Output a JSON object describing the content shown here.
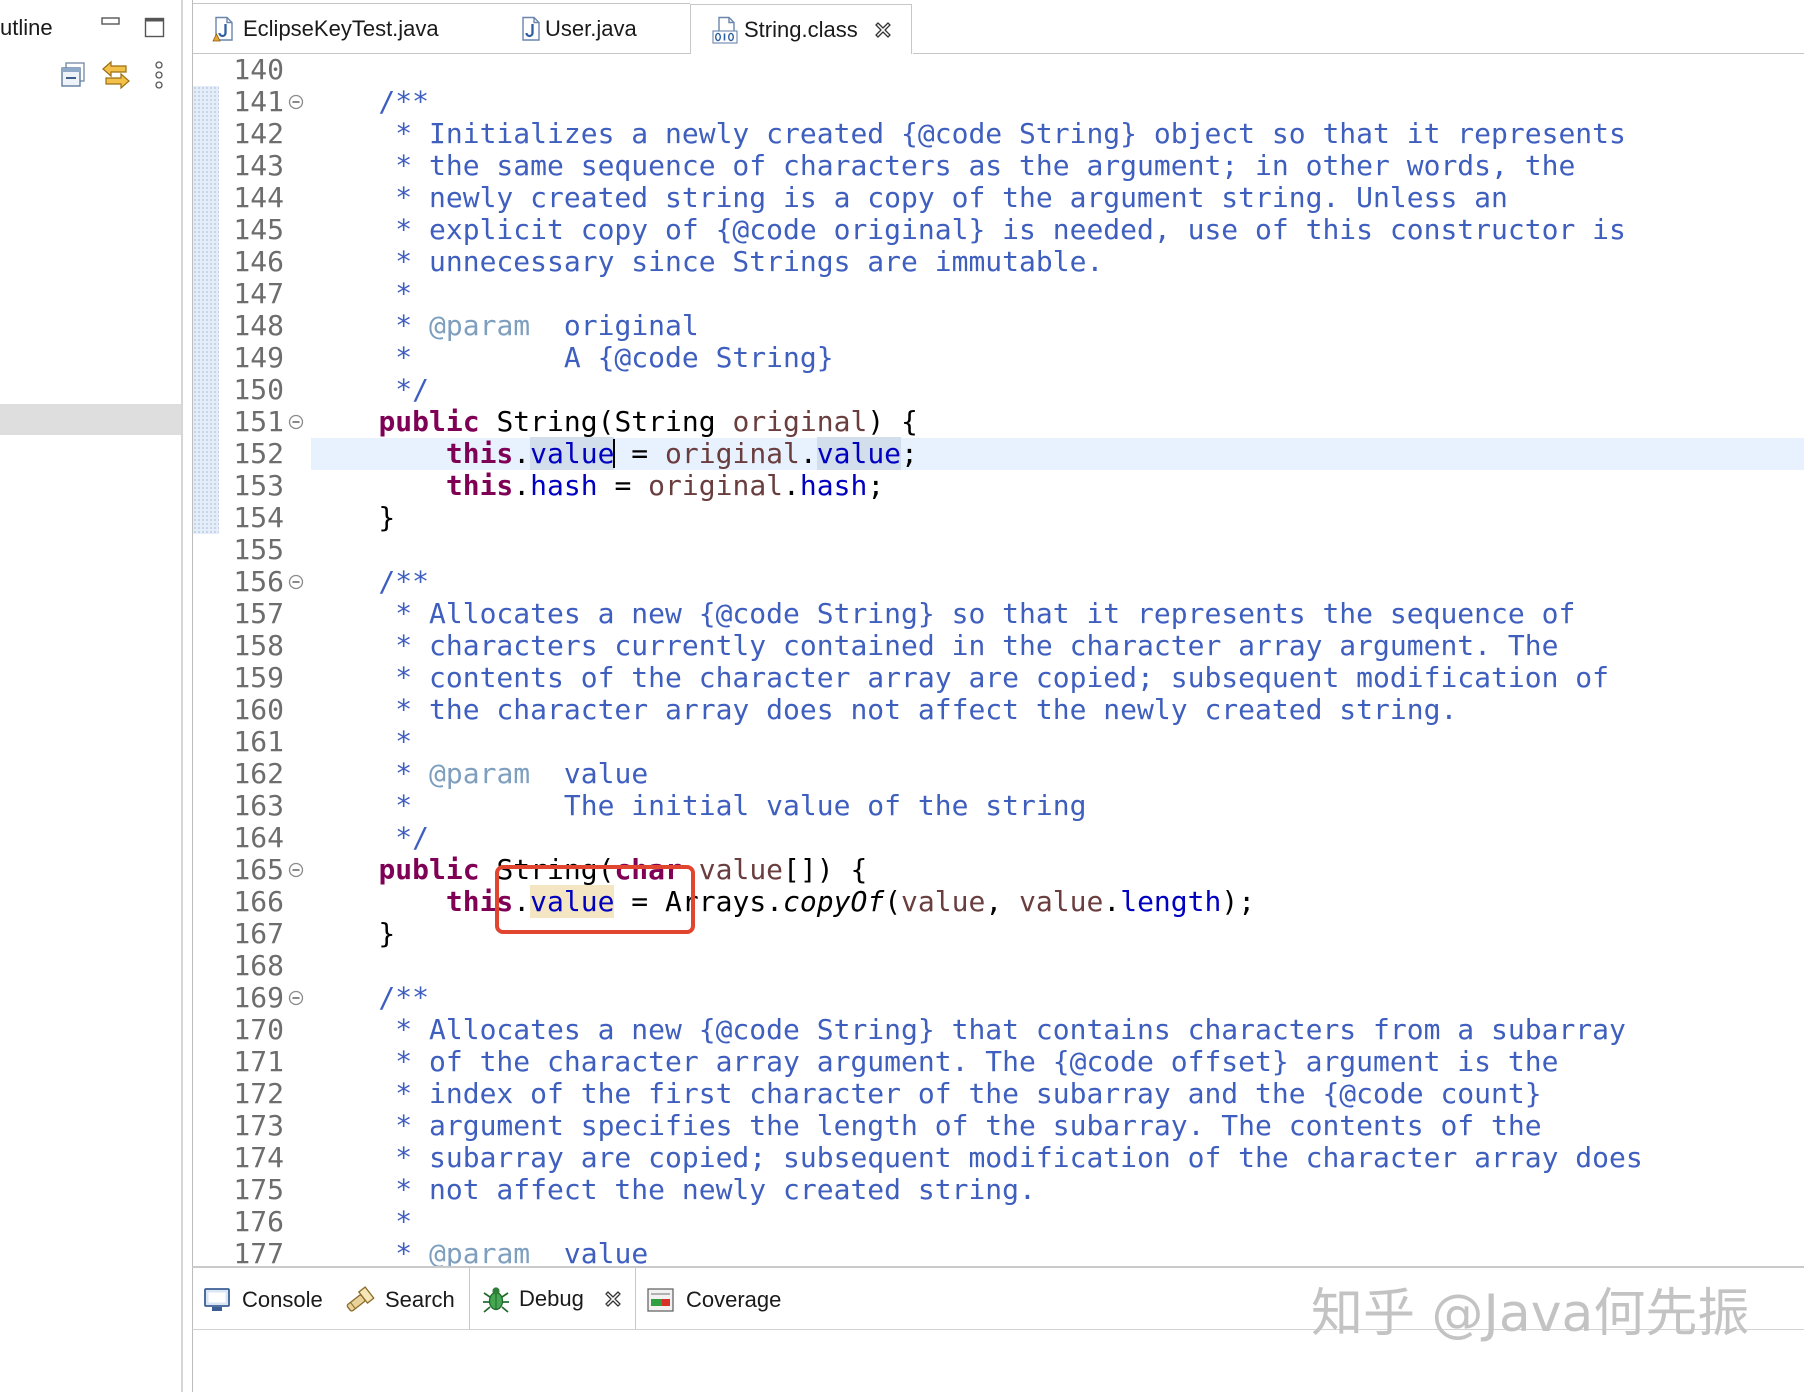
{
  "outline_panel": {
    "title": "utline",
    "icons": {
      "minimize": "minimize-icon",
      "maximize": "maximize-icon",
      "collapse_all": "collapse-all-icon",
      "link_with_editor": "link-with-editor-icon",
      "view_menu": "view-menu-icon"
    }
  },
  "editor": {
    "tabs": [
      {
        "label": "EclipseKeyTest.java",
        "icon": "java-file-icon",
        "active": false
      },
      {
        "label": "User.java",
        "icon": "java-file-icon",
        "active": false
      },
      {
        "label": "String.class",
        "icon": "class-file-icon",
        "active": true,
        "closable": true
      }
    ],
    "lines": [
      {
        "n": "140",
        "tokens": []
      },
      {
        "n": "141",
        "fold": true,
        "rng": true,
        "tokens": [
          {
            "t": "    /**",
            "s": "jd"
          }
        ]
      },
      {
        "n": "142",
        "rng": true,
        "tokens": [
          {
            "t": "     * Initializes a newly created {@code String} object so that it represents",
            "s": "jd"
          }
        ]
      },
      {
        "n": "143",
        "rng": true,
        "tokens": [
          {
            "t": "     * the same sequence of characters as the argument; in other words, the",
            "s": "jd"
          }
        ]
      },
      {
        "n": "144",
        "rng": true,
        "tokens": [
          {
            "t": "     * newly created string is a copy of the argument string. Unless an",
            "s": "jd"
          }
        ]
      },
      {
        "n": "145",
        "rng": true,
        "tokens": [
          {
            "t": "     * explicit copy of {@code original} is needed, use of this constructor is",
            "s": "jd"
          }
        ]
      },
      {
        "n": "146",
        "rng": true,
        "tokens": [
          {
            "t": "     * unnecessary since Strings are immutable.",
            "s": "jd"
          }
        ]
      },
      {
        "n": "147",
        "rng": true,
        "tokens": [
          {
            "t": "     *",
            "s": "jd"
          }
        ]
      },
      {
        "n": "148",
        "rng": true,
        "tokens": [
          {
            "t": "     * ",
            "s": "jd"
          },
          {
            "t": "@param",
            "s": "tag"
          },
          {
            "t": "  original",
            "s": "jd"
          }
        ]
      },
      {
        "n": "149",
        "rng": true,
        "tokens": [
          {
            "t": "     *         A {@code String}",
            "s": "jd"
          }
        ]
      },
      {
        "n": "150",
        "rng": true,
        "tokens": [
          {
            "t": "     */",
            "s": "jd"
          }
        ]
      },
      {
        "n": "151",
        "fold": true,
        "rng": true,
        "tokens": [
          {
            "t": "    ",
            "s": "pl"
          },
          {
            "t": "public",
            "s": "kw"
          },
          {
            "t": " String(String ",
            "s": "pl"
          },
          {
            "t": "original",
            "s": "prm"
          },
          {
            "t": ") {",
            "s": "pl"
          }
        ]
      },
      {
        "n": "152",
        "rng": true,
        "cur": true,
        "tokens": [
          {
            "t": "        ",
            "s": "pl"
          },
          {
            "t": "this",
            "s": "kw"
          },
          {
            "t": ".",
            "s": "pl"
          },
          {
            "t": "value",
            "s": "fld",
            "hl": "read",
            "cursor": true
          },
          {
            "t": " = ",
            "s": "pl"
          },
          {
            "t": "original",
            "s": "prm"
          },
          {
            "t": ".",
            "s": "pl"
          },
          {
            "t": "value",
            "s": "fld",
            "hl": "read"
          },
          {
            "t": ";",
            "s": "pl"
          }
        ]
      },
      {
        "n": "153",
        "rng": true,
        "tokens": [
          {
            "t": "        ",
            "s": "pl"
          },
          {
            "t": "this",
            "s": "kw"
          },
          {
            "t": ".",
            "s": "pl"
          },
          {
            "t": "hash",
            "s": "fld"
          },
          {
            "t": " = ",
            "s": "pl"
          },
          {
            "t": "original",
            "s": "prm"
          },
          {
            "t": ".",
            "s": "pl"
          },
          {
            "t": "hash",
            "s": "fld"
          },
          {
            "t": ";",
            "s": "pl"
          }
        ]
      },
      {
        "n": "154",
        "rng": true,
        "tokens": [
          {
            "t": "    }",
            "s": "pl"
          }
        ]
      },
      {
        "n": "155",
        "tokens": []
      },
      {
        "n": "156",
        "fold": true,
        "tokens": [
          {
            "t": "    /**",
            "s": "jd"
          }
        ]
      },
      {
        "n": "157",
        "tokens": [
          {
            "t": "     * Allocates a new {@code String} so that it represents the sequence of",
            "s": "jd"
          }
        ]
      },
      {
        "n": "158",
        "tokens": [
          {
            "t": "     * characters currently contained in the character array argument. The",
            "s": "jd"
          }
        ]
      },
      {
        "n": "159",
        "tokens": [
          {
            "t": "     * contents of the character array are copied; subsequent modification of",
            "s": "jd"
          }
        ]
      },
      {
        "n": "160",
        "tokens": [
          {
            "t": "     * the character array does not affect the newly created string.",
            "s": "jd"
          }
        ]
      },
      {
        "n": "161",
        "tokens": [
          {
            "t": "     *",
            "s": "jd"
          }
        ]
      },
      {
        "n": "162",
        "tokens": [
          {
            "t": "     * ",
            "s": "jd"
          },
          {
            "t": "@param",
            "s": "tag"
          },
          {
            "t": "  value",
            "s": "jd"
          }
        ]
      },
      {
        "n": "163",
        "tokens": [
          {
            "t": "     *         The initial value of the string",
            "s": "jd"
          }
        ]
      },
      {
        "n": "164",
        "tokens": [
          {
            "t": "     */",
            "s": "jd"
          }
        ]
      },
      {
        "n": "165",
        "fold": true,
        "tokens": [
          {
            "t": "    ",
            "s": "pl"
          },
          {
            "t": "public",
            "s": "kw"
          },
          {
            "t": " String(",
            "s": "pl"
          },
          {
            "t": "char",
            "s": "kw"
          },
          {
            "t": " ",
            "s": "pl"
          },
          {
            "t": "value",
            "s": "prm"
          },
          {
            "t": "[]) {",
            "s": "pl"
          }
        ]
      },
      {
        "n": "166",
        "tokens": [
          {
            "t": "        ",
            "s": "pl"
          },
          {
            "t": "this",
            "s": "kw"
          },
          {
            "t": ".",
            "s": "pl"
          },
          {
            "t": "value",
            "s": "fld",
            "hl": "write"
          },
          {
            "t": " = Arrays.",
            "s": "pl"
          },
          {
            "t": "copyOf",
            "s": "sm"
          },
          {
            "t": "(",
            "s": "pl"
          },
          {
            "t": "value",
            "s": "prm"
          },
          {
            "t": ", ",
            "s": "pl"
          },
          {
            "t": "value",
            "s": "prm"
          },
          {
            "t": ".",
            "s": "pl"
          },
          {
            "t": "length",
            "s": "fld"
          },
          {
            "t": ");",
            "s": "pl"
          }
        ]
      },
      {
        "n": "167",
        "tokens": [
          {
            "t": "    }",
            "s": "pl"
          }
        ]
      },
      {
        "n": "168",
        "tokens": []
      },
      {
        "n": "169",
        "fold": true,
        "tokens": [
          {
            "t": "    /**",
            "s": "jd"
          }
        ]
      },
      {
        "n": "170",
        "tokens": [
          {
            "t": "     * Allocates a new {@code String} that contains characters from a subarray",
            "s": "jd"
          }
        ]
      },
      {
        "n": "171",
        "tokens": [
          {
            "t": "     * of the character array argument. The {@code offset} argument is the",
            "s": "jd"
          }
        ]
      },
      {
        "n": "172",
        "tokens": [
          {
            "t": "     * index of the first character of the subarray and the {@code count}",
            "s": "jd"
          }
        ]
      },
      {
        "n": "173",
        "tokens": [
          {
            "t": "     * argument specifies the length of the subarray. The contents of the",
            "s": "jd"
          }
        ]
      },
      {
        "n": "174",
        "tokens": [
          {
            "t": "     * subarray are copied; subsequent modification of the character array does",
            "s": "jd"
          }
        ]
      },
      {
        "n": "175",
        "tokens": [
          {
            "t": "     * not affect the newly created string.",
            "s": "jd"
          }
        ]
      },
      {
        "n": "176",
        "tokens": [
          {
            "t": "     *",
            "s": "jd"
          }
        ]
      },
      {
        "n": "177",
        "tokens": [
          {
            "t": "     * ",
            "s": "jd"
          },
          {
            "t": "@param",
            "s": "tag"
          },
          {
            "t": "  value",
            "s": "jd"
          }
        ]
      }
    ]
  },
  "bottom_panel": {
    "tabs": [
      {
        "label": "Console",
        "icon": "console-icon",
        "active": false
      },
      {
        "label": "Search",
        "icon": "search-icon",
        "active": false
      },
      {
        "label": "Debug",
        "icon": "debug-icon",
        "active": true,
        "closable": true
      },
      {
        "label": "Coverage",
        "icon": "coverage-icon",
        "active": false
      }
    ]
  },
  "watermark": "知乎 @Java何先振",
  "colors": {
    "javadoc": "#3f5fbf",
    "javadoc_tag": "#7f9fbf",
    "keyword": "#7f0055",
    "field": "#0000c0",
    "parameter": "#6a3e3e",
    "line_number": "#6d6d6d",
    "current_line": "#e8f2fe",
    "read_occurrence": "#d3deec",
    "write_occurrence": "#f4e5c3",
    "annotation": "#e2452f"
  }
}
